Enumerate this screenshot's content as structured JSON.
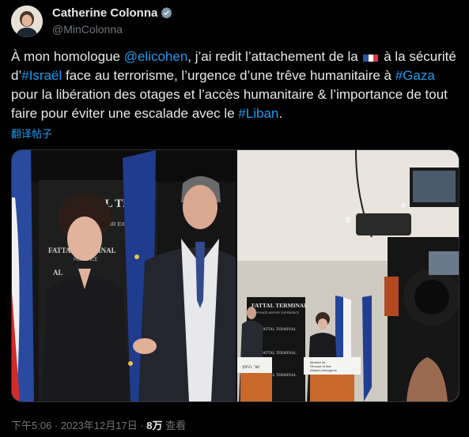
{
  "author": {
    "display_name": "Catherine Colonna",
    "handle": "@MinColonna"
  },
  "tweet": {
    "t1": "À mon homologue ",
    "mention": "@elicohen",
    "t2": ", j’ai redit l’attachement de la ",
    "t3": " à la sécurité d’",
    "hashtag_israel": "#Israël",
    "t4": " face au terrorisme, l’urgence d’une trêve humanitaire à ",
    "hashtag_gaza": "#Gaza",
    "t5": " pour la libération des otages et l’accès humanitaire & l’importance de tout faire pour éviter une escalade avec le ",
    "hashtag_liban": "#Liban",
    "t6": "."
  },
  "translate_label": "翻译帖子",
  "media": {
    "left_sign_line1": "FATTAL TERMI",
    "left_sign_line2": "AIR  EXPERI",
    "left_sign_line3": "FATTAL TERMINAL",
    "left_sign_line4": "PERIENCE",
    "left_sign_line5": "AL",
    "right_sign_main": "FATTAL TERMINAL",
    "right_sign_sub": "PRIVATE AIRPORT EXPERIENCE",
    "right_sign_repeat": "FATTAL TERMINAL",
    "podium_left": "שר החוץ",
    "podium_right_line1": "Ministre de",
    "podium_right_line2": "l'Europe et des",
    "podium_right_line3": "Affaires étrangères"
  },
  "meta": {
    "time": "下午5:06",
    "sep": " · ",
    "date": "2023年12月17日",
    "views_count": "8万",
    "views_label": " 查看"
  },
  "colors": {
    "background": "#000000",
    "text": "#e7e9ea",
    "secondary": "#71767b",
    "link": "#1d9bf0",
    "verified": "#829aab"
  }
}
